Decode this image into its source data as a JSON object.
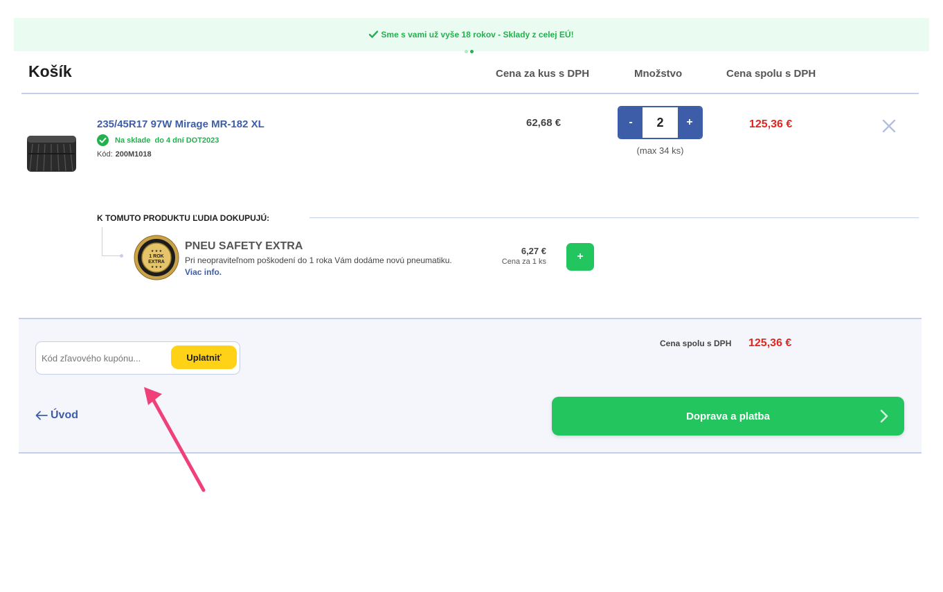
{
  "banner": {
    "text": "Sme s vami už vyše 18 rokov - Sklady z celej EÚ!"
  },
  "cart": {
    "title": "Košík",
    "columns": {
      "unit_price": "Cena za kus s DPH",
      "quantity": "Množstvo",
      "total": "Cena spolu s DPH"
    }
  },
  "item": {
    "name": "235/45R17 97W Mirage MR-182 XL",
    "stock": "Na sklade  do 4 dní DOT2023",
    "code_label": "Kód:",
    "code": "200M1018",
    "unit_price": "62,68 €",
    "qty_minus": "-",
    "qty_plus": "+",
    "quantity": "2",
    "qty_max": "(max 34 ks)",
    "total_price": "125,36 €"
  },
  "upsell": {
    "title": "K TOMUTO PRODUKTU ĽUDIA DOKUPUJÚ:",
    "badge_line1": "1 ROK",
    "badge_line2": "EXTRA",
    "name": "PNEU SAFETY EXTRA",
    "description": "Pri neopraviteľnom poškodení do 1 roka Vám dodáme novú pneumatiku.",
    "more_info": "Viac info.",
    "price": "6,27 €",
    "price_note": "Cena za 1 ks",
    "add_label": "+"
  },
  "footer": {
    "coupon_placeholder": "Kód zľavového kupónu...",
    "coupon_button": "Uplatniť",
    "sum_label": "Cena spolu s DPH",
    "sum_value": "125,36 €",
    "back_label": "Úvod",
    "checkout_label": "Doprava a platba"
  },
  "colors": {
    "accent_blue": "#3d5da8",
    "green": "#22c55e",
    "price_red": "#e1261c",
    "coupon_yellow": "#ffd117",
    "annotation_pink": "#f0407a"
  }
}
